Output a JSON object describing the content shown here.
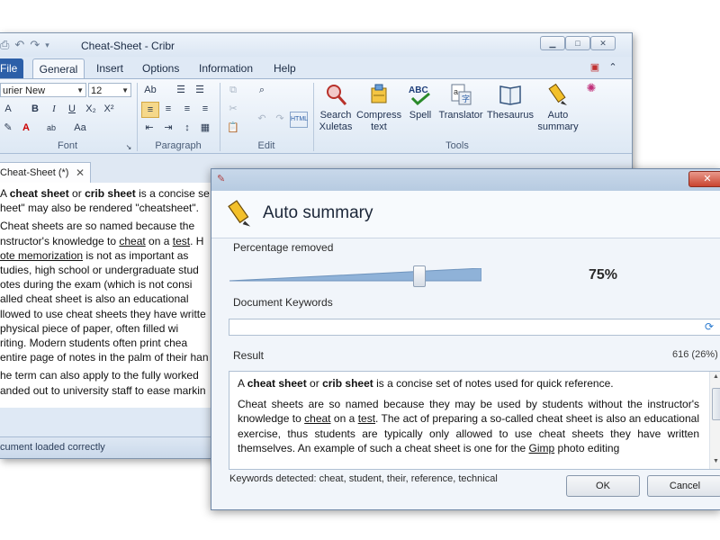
{
  "main_window": {
    "title": "Cheat-Sheet - Cribr",
    "tabs": [
      "File",
      "General",
      "Insert",
      "Options",
      "Information",
      "Help"
    ],
    "font": {
      "name": "urier New",
      "size": "12"
    },
    "groups": {
      "font": "Font",
      "paragraph": "Paragraph",
      "edit": "Edit",
      "tools": "Tools"
    },
    "tools": [
      {
        "line1": "Search",
        "line2": "Xuletas",
        "icon": "search-xuletas-icon"
      },
      {
        "line1": "Compress",
        "line2": "text",
        "icon": "compress-icon"
      },
      {
        "line1": "Spell",
        "line2": "",
        "icon": "spell-check-icon"
      },
      {
        "line1": "Translator",
        "line2": "",
        "icon": "translator-icon"
      },
      {
        "line1": "Thesaurus",
        "line2": "",
        "icon": "thesaurus-icon"
      },
      {
        "line1": "Auto",
        "line2": "summary",
        "icon": "pencil-icon"
      }
    ],
    "doc_tab": "Cheat-Sheet (*)",
    "status": "cument loaded correctly",
    "editor": {
      "p1": {
        "a": "A ",
        "b": "cheat sheet",
        "c": " or ",
        "d": "crib sheet",
        "e": " is a concise se",
        "f": "heet\" may also be rendered \"cheatsheet\"."
      },
      "p2": {
        "l1": "Cheat sheets are so named because the",
        "l2a": "nstructor's knowledge to ",
        "l2b": "cheat",
        "l2c": " on a ",
        "l2d": "test",
        "l2e": ". H",
        "l3a": "ote memorization",
        "l3b": " is not as important as",
        "l4": "tudies, high school or undergraduate stud",
        "l5": "otes during the exam (which is not consi",
        "l6": "alled cheat sheet is also an educational",
        "l7": "llowed to use cheat sheets they have writte",
        "l8": "physical piece of paper, often filled wi",
        "l9": "riting. Modern students often print chea",
        "l10": "entire page of notes in the palm of their han"
      },
      "p3": {
        "l1": "he term can also apply to the fully worked",
        "l2": "anded out to university staff to ease markin"
      }
    }
  },
  "dialog": {
    "title": "Auto summary",
    "percentage_label": "Percentage removed",
    "percentage_removed": 75,
    "percentage_text": "75%",
    "keywords_label": "Document Keywords",
    "keywords_value": "",
    "result_label": "Result",
    "result_count": "616 (26%)",
    "result": {
      "p1": {
        "a": "A ",
        "b": "cheat sheet",
        "c": " or ",
        "d": "crib sheet",
        "e": " is a concise set of notes used for quick reference."
      },
      "p2": {
        "a": "Cheat sheets are so named because they may be used by students without the instructor's knowledge to ",
        "b": "cheat",
        "c": " on a ",
        "d": "test",
        "e": ". The act of preparing a so-called cheat sheet is also an educational exercise, thus students are typically only allowed to use cheat sheets they have written themselves. An example of such a cheat sheet is one for the ",
        "f": "Gimp",
        "g": " photo editing"
      }
    },
    "keywords_detected": "Keywords detected: cheat, student, their, reference, technical",
    "ok_label": "OK",
    "cancel_label": "Cancel"
  },
  "colors": {
    "accent": "#2c5fa8",
    "slider_fill": "#8fb2d8",
    "close_button": "#c9442f"
  }
}
